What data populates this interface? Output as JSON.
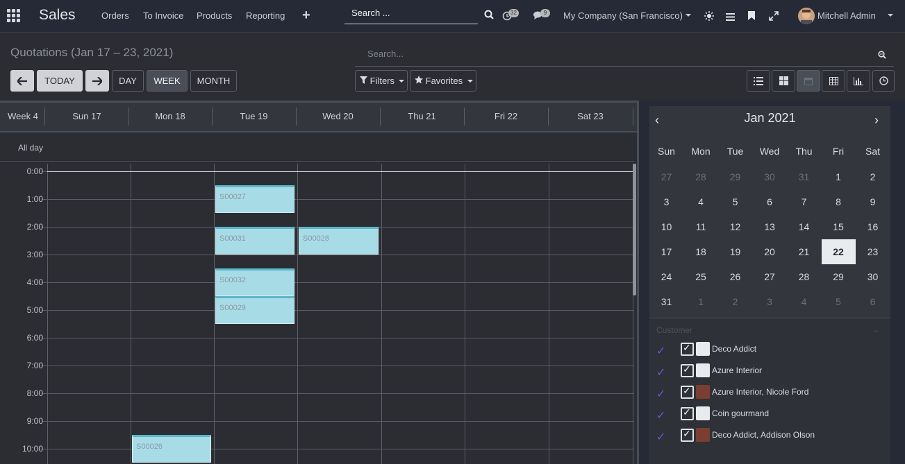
{
  "navbar": {
    "app_name": "Sales",
    "menu": [
      "Orders",
      "To Invoice",
      "Products",
      "Reporting"
    ],
    "search_placeholder": "Search ...",
    "activity_count": "32",
    "messages_count": "9",
    "company": "My Company (San Francisco)",
    "user": "Mitchell Admin"
  },
  "control_panel": {
    "title": "Quotations (Jan 17 – 23, 2021)",
    "search_placeholder": "Search...",
    "today_label": "TODAY",
    "scale_buttons": [
      "DAY",
      "WEEK",
      "MONTH"
    ],
    "active_scale": "WEEK",
    "filters_label": "Filters",
    "favorites_label": "Favorites",
    "views": [
      "list-view-icon",
      "kanban-view-icon",
      "calendar-view-icon",
      "pivot-view-icon",
      "graph-view-icon",
      "activity-view-icon"
    ]
  },
  "calendar": {
    "week_label": "Week 4",
    "days": [
      "Sun 17",
      "Mon 18",
      "Tue 19",
      "Wed 20",
      "Thu 21",
      "Fri 22",
      "Sat 23"
    ],
    "all_day_label": "All day",
    "hours": [
      "0:00",
      "1:00",
      "2:00",
      "3:00",
      "4:00",
      "5:00",
      "6:00",
      "7:00",
      "8:00",
      "9:00",
      "10:00"
    ],
    "events": [
      {
        "name": "S00027",
        "day": 2,
        "start": 0.5,
        "end": 1.5
      },
      {
        "name": "S00031",
        "day": 2,
        "start": 2.0,
        "end": 3.0
      },
      {
        "name": "S00028",
        "day": 3,
        "start": 2.0,
        "end": 3.0
      },
      {
        "name": "S00032",
        "day": 2,
        "start": 3.5,
        "end": 4.5
      },
      {
        "name": "S00029",
        "day": 2,
        "start": 4.5,
        "end": 5.5
      },
      {
        "name": "S00026",
        "day": 1,
        "start": 9.5,
        "end": 10.5
      }
    ]
  },
  "mini_calendar": {
    "month_label": "Jan 2021",
    "weekdays": [
      "Sun",
      "Mon",
      "Tue",
      "Wed",
      "Thu",
      "Fri",
      "Sat"
    ],
    "weeks": [
      [
        "27",
        "28",
        "29",
        "30",
        "31",
        "1",
        "2"
      ],
      [
        "3",
        "4",
        "5",
        "6",
        "7",
        "8",
        "9"
      ],
      [
        "10",
        "11",
        "12",
        "13",
        "14",
        "15",
        "16"
      ],
      [
        "17",
        "18",
        "19",
        "20",
        "21",
        "22",
        "23"
      ],
      [
        "24",
        "25",
        "26",
        "27",
        "28",
        "29",
        "30"
      ],
      [
        "31",
        "1",
        "2",
        "3",
        "4",
        "5",
        "6"
      ]
    ],
    "selected": "22"
  },
  "filters": {
    "section_label": "Customer",
    "items": [
      {
        "label": "Deco Addict",
        "avatar": "company-logo-icon"
      },
      {
        "label": "Azure Interior",
        "avatar": "company-logo-icon"
      },
      {
        "label": "Azure Interior, Nicole Ford",
        "avatar": "person-avatar-icon"
      },
      {
        "label": "Coin gourmand",
        "avatar": "company-logo-icon"
      },
      {
        "label": "Deco Addict, Addison Olson",
        "avatar": "person-avatar-icon"
      }
    ]
  },
  "colors": {
    "event_fill": "#a7dce7",
    "event_border": "#5ab6c9",
    "check": "#7b4fd3"
  }
}
